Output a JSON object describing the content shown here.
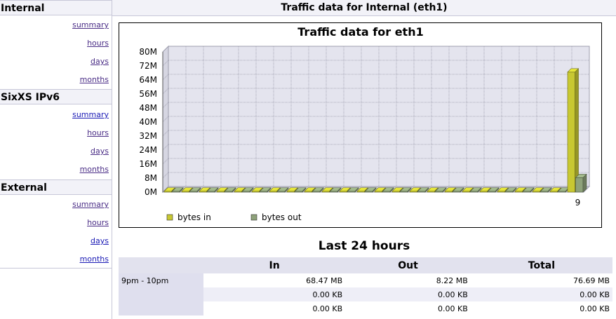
{
  "sidebar": {
    "sections": [
      {
        "title": "Internal",
        "links": [
          "summary",
          "hours",
          "days",
          "months"
        ]
      },
      {
        "title": "SixXS IPv6",
        "links": [
          "summary",
          "hours",
          "days",
          "months"
        ]
      },
      {
        "title": "External",
        "links": [
          "summary",
          "hours",
          "days",
          "months"
        ]
      }
    ]
  },
  "page": {
    "header": "Traffic data for Internal (eth1)"
  },
  "chart_data": {
    "type": "bar",
    "title": "Traffic data for eth1",
    "xlabel": "",
    "ylabel": "",
    "ylim": [
      0,
      80
    ],
    "y_unit": "M",
    "y_ticks": [
      "0M",
      "8M",
      "16M",
      "24M",
      "32M",
      "40M",
      "48M",
      "56M",
      "64M",
      "72M",
      "80M"
    ],
    "categories": [
      "",
      "",
      "",
      "",
      "",
      "",
      "",
      "",
      "",
      "",
      "",
      "",
      "",
      "",
      "",
      "",
      "",
      "",
      "",
      "",
      "",
      "",
      "",
      "9"
    ],
    "series": [
      {
        "name": "bytes in",
        "color": "#c8c832",
        "values": [
          0,
          0,
          0,
          0,
          0,
          0,
          0,
          0,
          0,
          0,
          0,
          0,
          0,
          0,
          0,
          0,
          0,
          0,
          0,
          0,
          0,
          0,
          0,
          68.47
        ]
      },
      {
        "name": "bytes out",
        "color": "#8ea27a",
        "values": [
          0,
          0,
          0,
          0,
          0,
          0,
          0,
          0,
          0,
          0,
          0,
          0,
          0,
          0,
          0,
          0,
          0,
          0,
          0,
          0,
          0,
          0,
          0,
          8.22
        ]
      }
    ],
    "legend_position": "bottom-left",
    "grid": true
  },
  "table": {
    "title": "Last 24 hours",
    "columns": [
      "In",
      "Out",
      "Total"
    ],
    "rows": [
      {
        "label": "9pm - 10pm",
        "in": "68.47 MB",
        "out": "8.22 MB",
        "total": "76.69 MB"
      },
      {
        "label": "",
        "in": "0.00 KB",
        "out": "0.00 KB",
        "total": "0.00 KB"
      },
      {
        "label": "",
        "in": "0.00 KB",
        "out": "0.00 KB",
        "total": "0.00 KB"
      }
    ]
  }
}
